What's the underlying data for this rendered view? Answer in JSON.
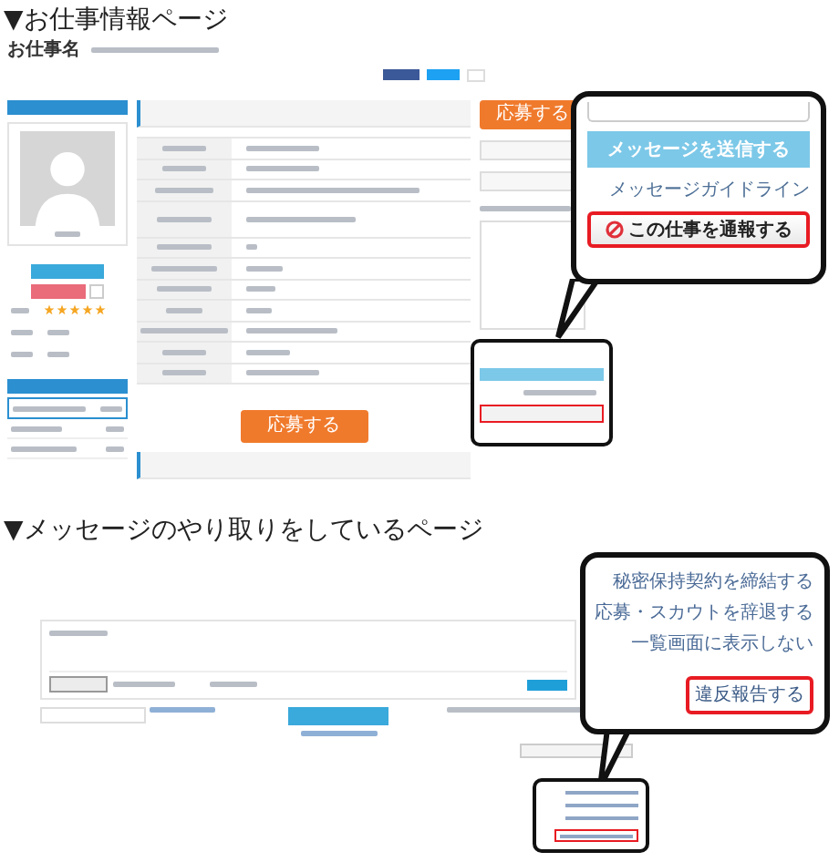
{
  "job_page": {
    "heading": "▼お仕事情報ページ",
    "job_title": "お仕事名",
    "client": {
      "stars": 5
    },
    "apply_button": "応募する",
    "side_apply_button": "応募する",
    "callout": {
      "send_button": "メッセージを送信する",
      "guideline_link": "メッセージガイドライン",
      "report_button": "この仕事を通報する",
      "report_highlighted": true
    }
  },
  "message_page": {
    "heading": "▼メッセージのやり取りをしているページ",
    "callout": {
      "actions": [
        {
          "label": "秘密保持契約を締結する",
          "highlighted": false
        },
        {
          "label": "応募・スカウトを辞退する",
          "highlighted": false
        },
        {
          "label": "一覧画面に表示しない",
          "highlighted": false
        },
        {
          "label": "違反報告する",
          "highlighted": true
        }
      ]
    }
  }
}
